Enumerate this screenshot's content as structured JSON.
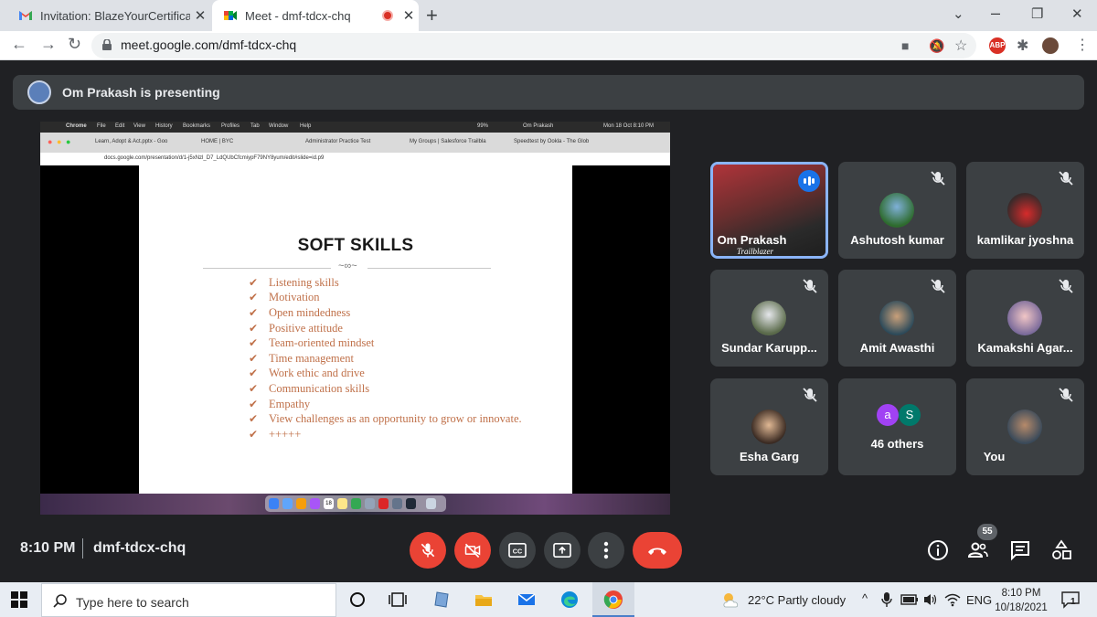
{
  "browser": {
    "tabs": [
      {
        "title": "Invitation: BlazeYourCertification",
        "icon": "gmail-icon"
      },
      {
        "title": "Meet - dmf-tdcx-chq",
        "icon": "meet-icon",
        "recording": true
      }
    ],
    "url": "meet.google.com/dmf-tdcx-chq",
    "extensions": {
      "abp": "ABP"
    }
  },
  "meet": {
    "presenting_text": "Om Prakash is presenting",
    "time": "8:10 PM",
    "code": "dmf-tdcx-chq",
    "participant_count": "55",
    "participants": [
      {
        "name": "Om Prakash",
        "speaking": true,
        "shirt_text": "Trailblazer"
      },
      {
        "name": "Ashutosh kumar",
        "muted": true
      },
      {
        "name": "kamlikar jyoshna",
        "muted": true
      },
      {
        "name": "Sundar Karupp...",
        "muted": true
      },
      {
        "name": "Amit Awasthi",
        "muted": true
      },
      {
        "name": "Kamakshi Agar...",
        "muted": true
      },
      {
        "name": "Esha Garg",
        "muted": true
      },
      {
        "name": "46 others",
        "avatars": [
          "a",
          "S"
        ]
      },
      {
        "name": "You",
        "muted": true
      }
    ]
  },
  "shared": {
    "mac_menu": [
      "Chrome",
      "File",
      "Edit",
      "View",
      "History",
      "Bookmarks",
      "Profiles",
      "Tab",
      "Window",
      "Help"
    ],
    "mac_status": {
      "battery": "99%",
      "user": "Om Prakash",
      "datetime": "Mon 18 Oct  8:10 PM"
    },
    "tabs": [
      "Learn, Adopt & Act.pptx - Goo",
      "HOME | BYC",
      "Administrator Practice Test",
      "My Groups | Salesforce Trailbla",
      "Speedtest by Ookla - The Glob"
    ],
    "url": "docs.google.com/presentation/d/1-j5xNzl_D7_LdQUbCfcmiypF79NY8yum/edit#slide=id.p9",
    "slide": {
      "title": "SOFT SKILLS",
      "items": [
        "Listening skills",
        "Motivation",
        "Open mindedness",
        "Positive attitude",
        "Team-oriented mindset",
        "Time management",
        "Work ethic and drive",
        "Communication skills",
        "Empathy",
        "View challenges as an opportunity to grow or innovate.",
        "+++++"
      ]
    },
    "dock_date": "18"
  },
  "taskbar": {
    "search_placeholder": "Type here to search",
    "weather": "22°C  Partly cloudy",
    "lang": "ENG",
    "time": "8:10 PM",
    "date": "10/18/2021",
    "notifications": "1"
  }
}
